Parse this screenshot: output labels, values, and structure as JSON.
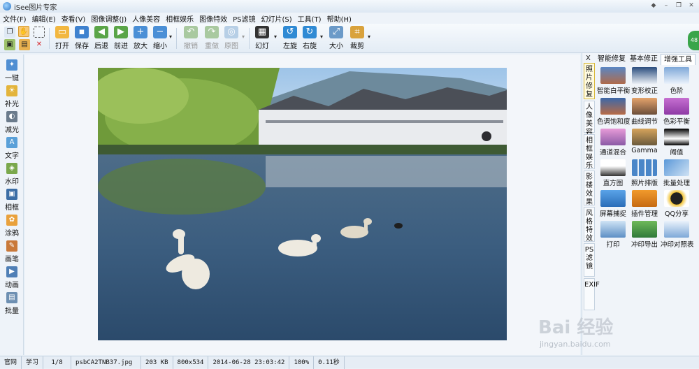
{
  "app": {
    "title": "iSee图片专家"
  },
  "window_buttons": [
    "◆",
    "–",
    "❐",
    "✕"
  ],
  "menu": [
    "文件(F)",
    "编辑(E)",
    "查看(V)",
    "图像调整(J)",
    "人像美容",
    "相框娱乐",
    "图像特效",
    "PS滤镜",
    "幻灯片(S)",
    "工具(T)",
    "帮助(H)"
  ],
  "toolbar": {
    "open": "打开",
    "save": "保存",
    "back": "后退",
    "forward": "前进",
    "zoom_in": "放大",
    "zoom_out": "缩小",
    "undo": "撤销",
    "redo": "重做",
    "original": "原图",
    "slideshow": "幻灯",
    "rotate_left": "左旋",
    "rotate_right": "右旋",
    "resize": "大小",
    "crop": "裁剪"
  },
  "left_tools": [
    "一键",
    "补光",
    "减光",
    "文字",
    "水印",
    "相框",
    "涂鸦",
    "画笔",
    "动画",
    "批量"
  ],
  "right_panel": {
    "close": "X",
    "tabs": [
      "智能修复",
      "基本修正",
      "增强工具"
    ],
    "active_tab": 2,
    "vertical_tabs": [
      "照片修复",
      "人像美容",
      "相框娱乐",
      "影楼效果",
      "风格特效",
      "PS滤镜",
      "EXIF"
    ],
    "tools": [
      "智能白平衡",
      "变形校正",
      "色阶",
      "色调饱和度",
      "曲线调节",
      "色彩平衡",
      "通道混合",
      "Gamma",
      "阈值",
      "直方图",
      "照片排版",
      "批量处理",
      "屏幕捕捉",
      "插件管理",
      "QQ分享",
      "打印",
      "冲印导出",
      "冲印对照表"
    ]
  },
  "status": {
    "site": "官网",
    "learn": "学习",
    "index": "1/8",
    "file": "psbCA2TNB37.jpg",
    "size": "203 KB",
    "dims": "800x534",
    "date": "2014-06-28 23:03:42",
    "zoom": "100%",
    "time": "0.11秒"
  },
  "watermark": {
    "brand": "Bai 经验",
    "url": "jingyan.baidu.com"
  },
  "side_badge": "48",
  "colors": {
    "accent": "#2a74c4",
    "panel": "#f0f4f9"
  }
}
